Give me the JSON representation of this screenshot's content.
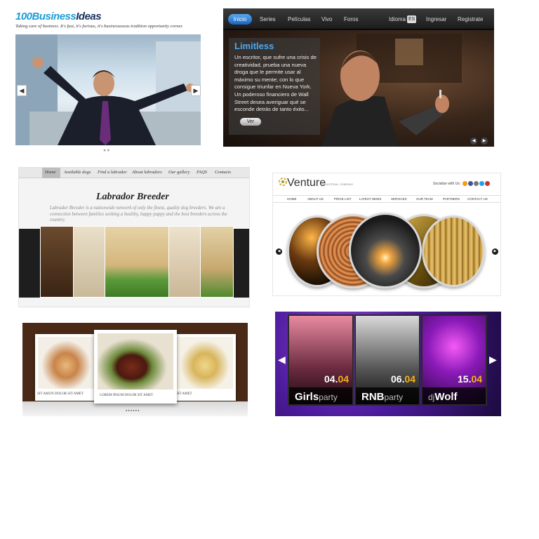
{
  "panel1": {
    "logo_a": "100Business",
    "logo_b": "Ideas",
    "tagline": "Taking care of business. It's fast, it's furious, it's businessuseas tradition opportunity corner.",
    "prev": "◀",
    "next": "▶",
    "dots": "●●"
  },
  "panel2": {
    "nav": [
      "Inicio",
      "Series",
      "Películas",
      "Vivo",
      "Foros",
      "Idioma",
      "Ingresar",
      "Registrate"
    ],
    "lang": "ES",
    "title": "Limitless",
    "description": "Un escritor, que sufre una crisis de creatividad, prueba una nueva droga que le permite usar al máximo su mente; con lo que consigue triunfar en Nueva York. Un poderoso financiero de Wall Street desea averiguar qué se esconde detrás de tanto éxito...",
    "button": "Ver",
    "prev": "◀",
    "next": "▶"
  },
  "panel3": {
    "menu": [
      "Home",
      "Available dogs",
      "Find a labrador",
      "About labradors",
      "Our gallery",
      "FAQS",
      "Contacts"
    ],
    "heading": "Labrador Breeder",
    "intro": "Labrador Breeder is a nationwide network of only the finest, quality dog breeders. We are a connection between families seeking a healthy, happy puppy and the best breeders across the country."
  },
  "panel4": {
    "logo": "Venture",
    "subtitle": "INDUSTRIAL COMPANY",
    "socialize": "Socialize with Us:",
    "menu": [
      "HOME",
      "ABOUT US",
      "PRICE LIST",
      "LATEST NEWS",
      "SERVICES",
      "OUR TEAM",
      "PARTNERS",
      "CONTACT US"
    ],
    "prev": "◀",
    "next": "▶"
  },
  "panel5": {
    "captions": [
      "SIT AMUN DOLOR SIT AMET",
      "LOREM IPSUM DOLOR SIT AMET",
      "SIT AMET"
    ],
    "dots": "●●●●●●"
  },
  "panel6": {
    "tiles": [
      {
        "date_a": "04.",
        "date_b": "04",
        "name": "Girls",
        "suffix": "party"
      },
      {
        "date_a": "06.",
        "date_b": "04",
        "name": "RNB",
        "suffix": "party"
      },
      {
        "date_a": "15.",
        "date_b": "04",
        "name": "Wolf",
        "suffix": "dj"
      }
    ],
    "prev": "◀",
    "next": "▶"
  }
}
